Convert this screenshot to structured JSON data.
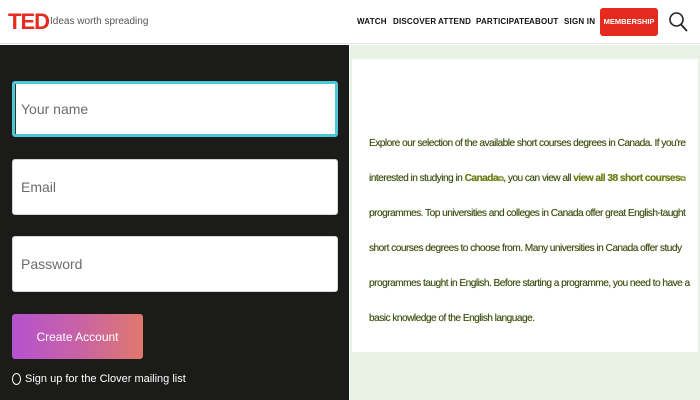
{
  "header": {
    "logo": "TED",
    "tagline": "Ideas worth spreading",
    "nav": [
      "WATCH",
      "DISCOVER",
      "ATTEND",
      "PARTICIPATE",
      "ABOUT",
      "SIGN IN"
    ],
    "membership_label": "MEMBERSHIP",
    "brand_color": "#e62b1e",
    "search_icon": "search-icon"
  },
  "form": {
    "name_placeholder": "Your name",
    "email_placeholder": "Email",
    "password_placeholder": "Password",
    "submit_label": "Create Account",
    "mailing_label": "Sign up for the Clover mailing list",
    "focus_color": "#4cc7d8"
  },
  "article": {
    "text_1": "Explore our selection of the available short courses degrees in Canada. If you're interested in studying in ",
    "link_1": "Canada",
    "text_2": ", you can view all ",
    "link_2": "view all 38 short courses",
    "text_3": " programmes. Top universities and colleges in Canada offer great English-taught short courses degrees to choose from. Many universities in Canada offer study programmes taught in English. Before starting a programme, you need to have a basic knowledge of the English language.",
    "ext_icon": "⧉"
  }
}
